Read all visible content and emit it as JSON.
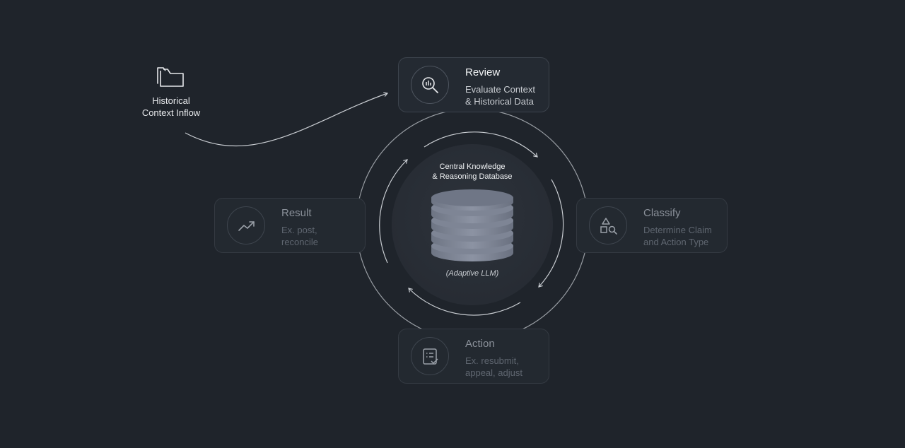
{
  "inflow": {
    "icon": "folder-icon",
    "label_line1": "Historical",
    "label_line2": "Context Inflow"
  },
  "hub": {
    "title_line1": "Central Knowledge",
    "title_line2": "& Reasoning Database",
    "icon": "database-icon",
    "subtitle": "(Adaptive LLM)"
  },
  "steps": {
    "review": {
      "icon": "magnifier-chart-icon",
      "title": "Review",
      "desc_line1": "Evaluate Context",
      "desc_line2": "& Historical Data"
    },
    "classify": {
      "icon": "shapes-search-icon",
      "title": "Classify",
      "desc_line1": "Determine Claim",
      "desc_line2": "and Action Type"
    },
    "action": {
      "icon": "checklist-icon",
      "title": "Action",
      "desc_line1": "Ex. resubmit,",
      "desc_line2": "appeal, adjust"
    },
    "result": {
      "icon": "trend-up-icon",
      "title": "Result",
      "desc_line1": "Ex. post,",
      "desc_line2": "reconcile"
    }
  },
  "colors": {
    "background": "#1f242b",
    "card": "#242a32",
    "line": "#c9cdd2",
    "text": "#f1f3f5"
  }
}
